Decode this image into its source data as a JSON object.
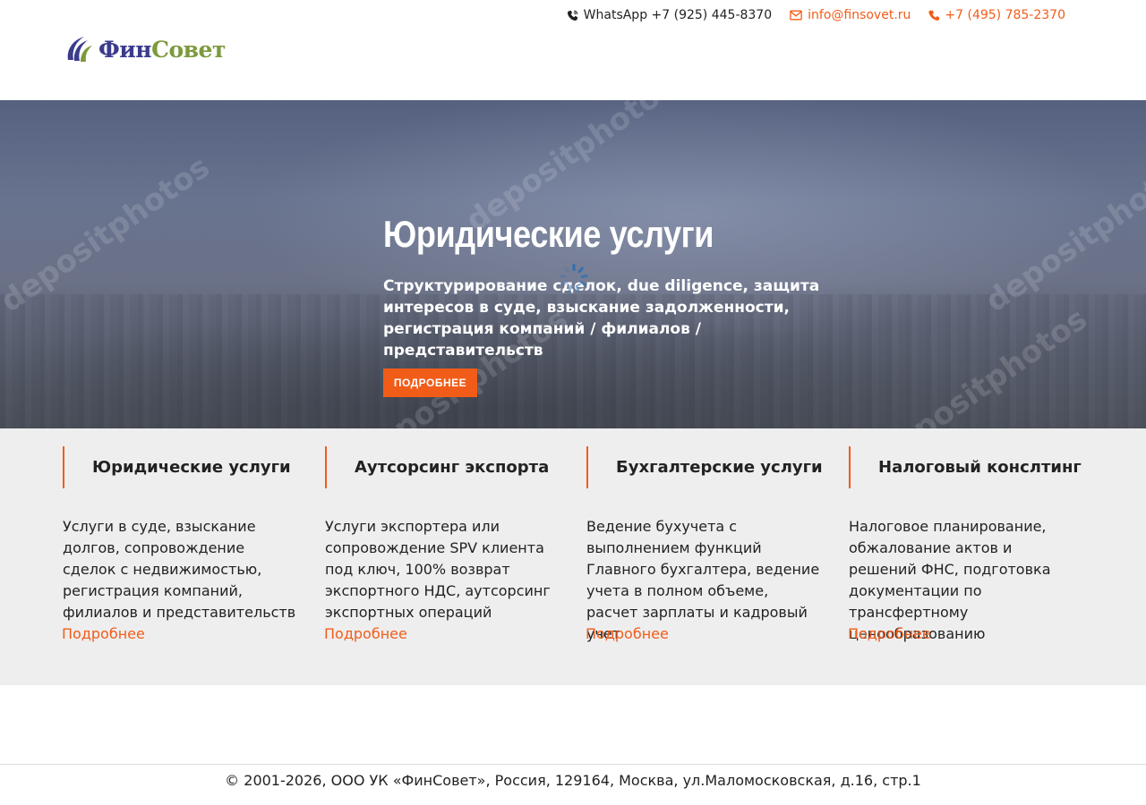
{
  "header": {
    "whatsapp": "WhatsApp +7 (925) 445-8370",
    "email": "info@finsovet.ru",
    "phone": "+7 (495) 785-2370"
  },
  "logo": {
    "part1": "Фин",
    "part2": "Совет"
  },
  "hero": {
    "title": "Юридические услуги",
    "subtitle": "Структурирование сделок, due diligence, защита интересов в суде, взыскание задолженности, регистрация компаний / филиалов / представительств",
    "button": "ПОДРОБНЕЕ",
    "watermark": "depositphotos"
  },
  "services": [
    {
      "title": "Юридические услуги",
      "description": "Услуги в суде, взыскание долгов, сопровождение сделок с недвижимостью, регистрация компаний, филиалов и представительств",
      "link": "Подробнее"
    },
    {
      "title": "Аутсорсинг экспорта",
      "description": "Услуги экспортера или сопровождение SPV клиента под ключ, 100% возврат экспортного НДС, аутсорсинг экспортных операций",
      "link": "Подробнее"
    },
    {
      "title": "Бухгалтерские услуги",
      "description": "Ведение бухучета с выполнением функций Главного бухгалтера, ведение учета в полном объеме, расчет зарплаты и кадровый учет",
      "link": "Подробнее"
    },
    {
      "title": "Налоговый конслтинг",
      "description": "Налоговое планирование, обжалование актов и решений ФНС, подготовка документации по трансфертному ценообразованию",
      "link": "Подробнее"
    }
  ],
  "footer": {
    "copyright": "© 2001-2026, ООО УК «ФинСовет», Россия, 129164, Москва, ул.Маломосковская, д.16, стр.1"
  },
  "colors": {
    "accent": "#f25c19",
    "logo_blue": "#3b3c8c",
    "logo_green": "#7c9a3c",
    "services_bg": "#eeeeee"
  }
}
